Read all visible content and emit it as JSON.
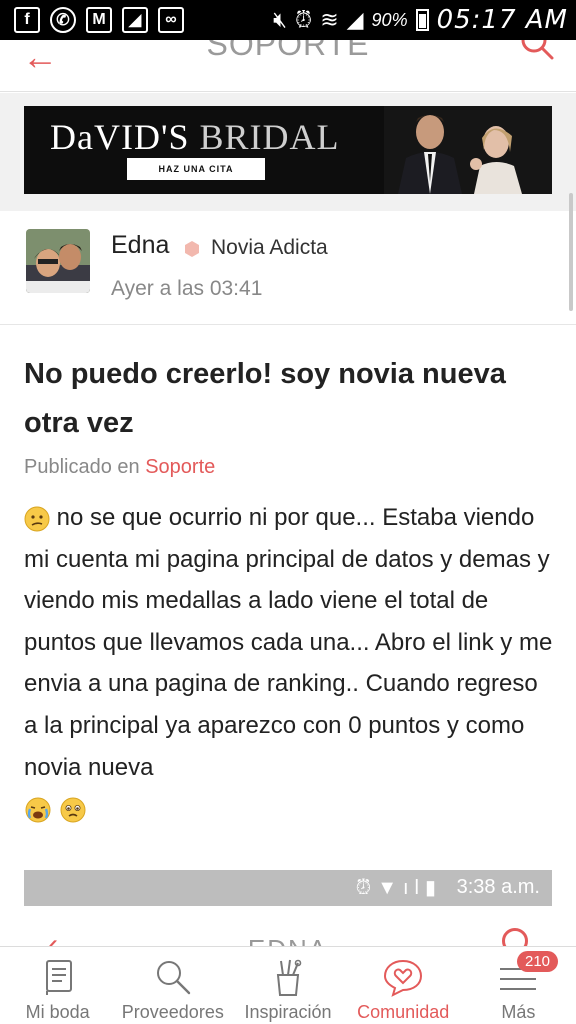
{
  "status_bar": {
    "battery_percent": "90%",
    "time": "05:17 AM",
    "icons": [
      "facebook-icon",
      "whatsapp-icon",
      "gmail-icon",
      "gallery-icon",
      "voicemail-icon",
      "mute-icon",
      "alarm-icon",
      "wifi-icon",
      "signal-icon",
      "battery-icon"
    ]
  },
  "header": {
    "title": "SOPORTE"
  },
  "ad": {
    "brand_bold": "DaVID'S",
    "brand_light": "BRIDAL",
    "cta": "HAZ UNA CITA"
  },
  "author": {
    "name": "Edna",
    "rank": "Novia Adicta",
    "time": "Ayer a las 03:41"
  },
  "post": {
    "title": "No puedo creerlo! soy novia nueva otra vez",
    "published_prefix": "Publicado en",
    "category": "Soporte",
    "body": "no se que ocurrio ni por que... Estaba viendo mi cuenta mi pagina principal de datos y demas y viendo mis medallas a lado viene el total de puntos que llevamos cada una... Abro el link y me envia a una pagina de ranking.. Cuando regreso a la principal ya aparezco con 0 puntos y como novia nueva"
  },
  "embedded_screenshot": {
    "time": "3:38 a.m.",
    "title": "EDNA"
  },
  "bottom_nav": {
    "items": [
      {
        "label": "Mi boda",
        "icon": "notebook-icon"
      },
      {
        "label": "Proveedores",
        "icon": "search-icon"
      },
      {
        "label": "Inspiración",
        "icon": "tools-icon"
      },
      {
        "label": "Comunidad",
        "icon": "heart-chat-icon"
      },
      {
        "label": "Más",
        "icon": "menu-icon"
      }
    ],
    "badge": "210",
    "active": "Comunidad"
  },
  "colors": {
    "accent": "#e35a5a",
    "status_bar": "#000000",
    "muted_text": "#888888"
  }
}
